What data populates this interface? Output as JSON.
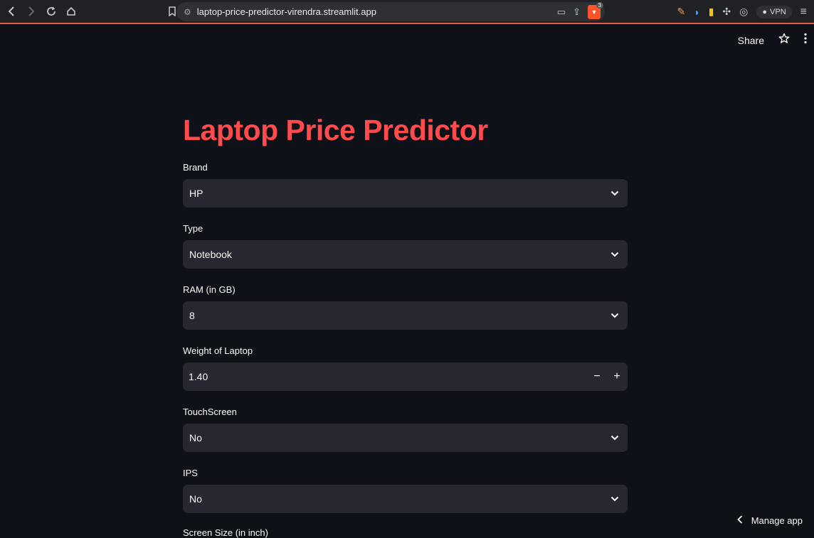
{
  "browser": {
    "url": "laptop-price-predictor-virendra.streamlit.app",
    "brave_badge_count": "3",
    "vpn_label": "VPN"
  },
  "header": {
    "share_label": "Share"
  },
  "app": {
    "title": "Laptop Price Predictor",
    "fields": {
      "brand": {
        "label": "Brand",
        "value": "HP"
      },
      "type": {
        "label": "Type",
        "value": "Notebook"
      },
      "ram": {
        "label": "RAM (in GB)",
        "value": "8"
      },
      "weight": {
        "label": "Weight of Laptop",
        "value": "1.40",
        "minus": "−",
        "plus": "+"
      },
      "touchscreen": {
        "label": "TouchScreen",
        "value": "No"
      },
      "ips": {
        "label": "IPS",
        "value": "No"
      },
      "screen_size": {
        "label": "Screen Size (in inch)"
      }
    }
  },
  "footer": {
    "manage_app_label": "Manage app"
  },
  "colors": {
    "accent": "#ff4b4b",
    "background": "#0e1117",
    "input_bg": "#262730"
  }
}
